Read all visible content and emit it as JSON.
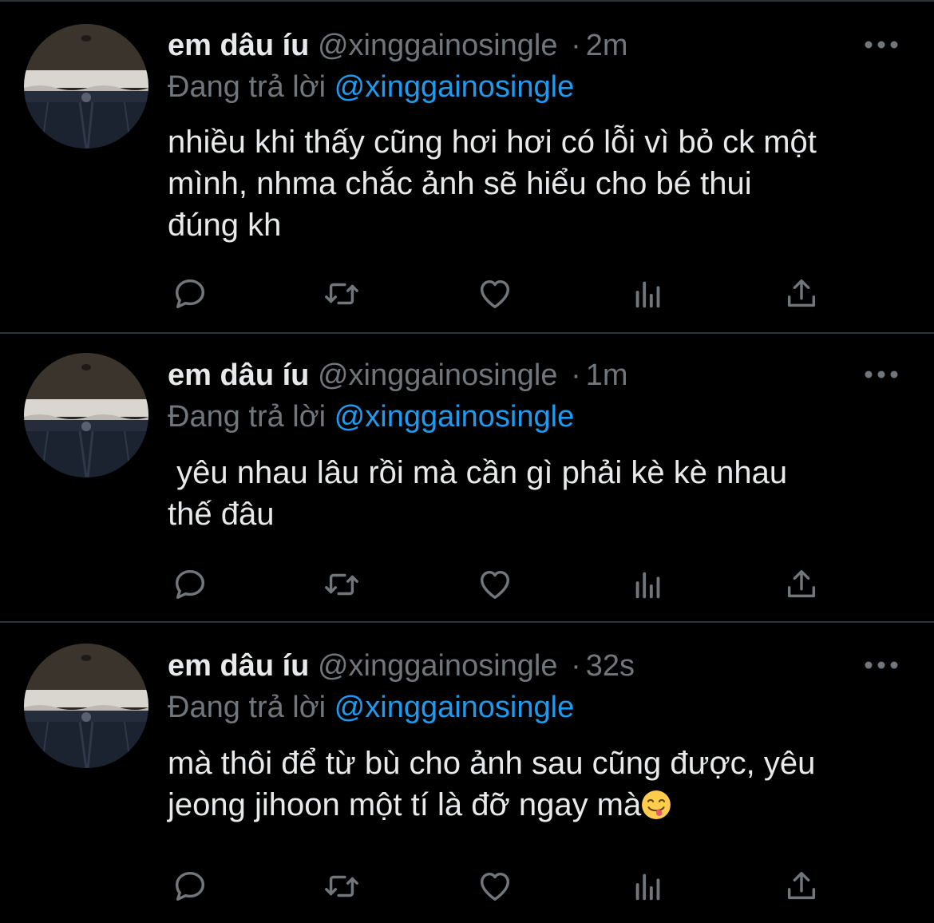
{
  "colors": {
    "background": "#000000",
    "divider": "#2f3336",
    "text_primary": "#e7e9ea",
    "text_secondary": "#71767b",
    "link": "#1d9bf0",
    "icon": "#71767b"
  },
  "icons": {
    "more": "more-horizontal-icon",
    "reply": "reply-bubble-icon",
    "retweet": "retweet-icon",
    "like": "heart-icon",
    "views": "views-bars-icon",
    "share": "share-upload-icon",
    "emoji": "face-savoring-food-emoji"
  },
  "tweets": [
    {
      "name": "em dâu íu",
      "handle": "@xinggainosingle",
      "separator": "·",
      "time": "2m",
      "reply_prefix": "Đang trả lời",
      "reply_to": "@xinggainosingle",
      "text": "nhiều khi thấy cũng hơi hơi có lỗi vì bỏ ck một\nmình, nhma chắc ảnh sẽ hiểu cho bé thui\nđúng kh"
    },
    {
      "name": "em dâu íu",
      "handle": "@xinggainosingle",
      "separator": "·",
      "time": "1m",
      "reply_prefix": "Đang trả lời",
      "reply_to": "@xinggainosingle",
      "text": " yêu nhau lâu rồi mà cần gì phải kè kè nhau\nthế đâu"
    },
    {
      "name": "em dâu íu",
      "handle": "@xinggainosingle",
      "separator": "·",
      "time": "32s",
      "reply_prefix": "Đang trả lời",
      "reply_to": "@xinggainosingle",
      "text": "mà thôi để từ bù cho ảnh sau cũng được, yêu\njeong jihoon một tí là đỡ ngay mà"
    }
  ]
}
